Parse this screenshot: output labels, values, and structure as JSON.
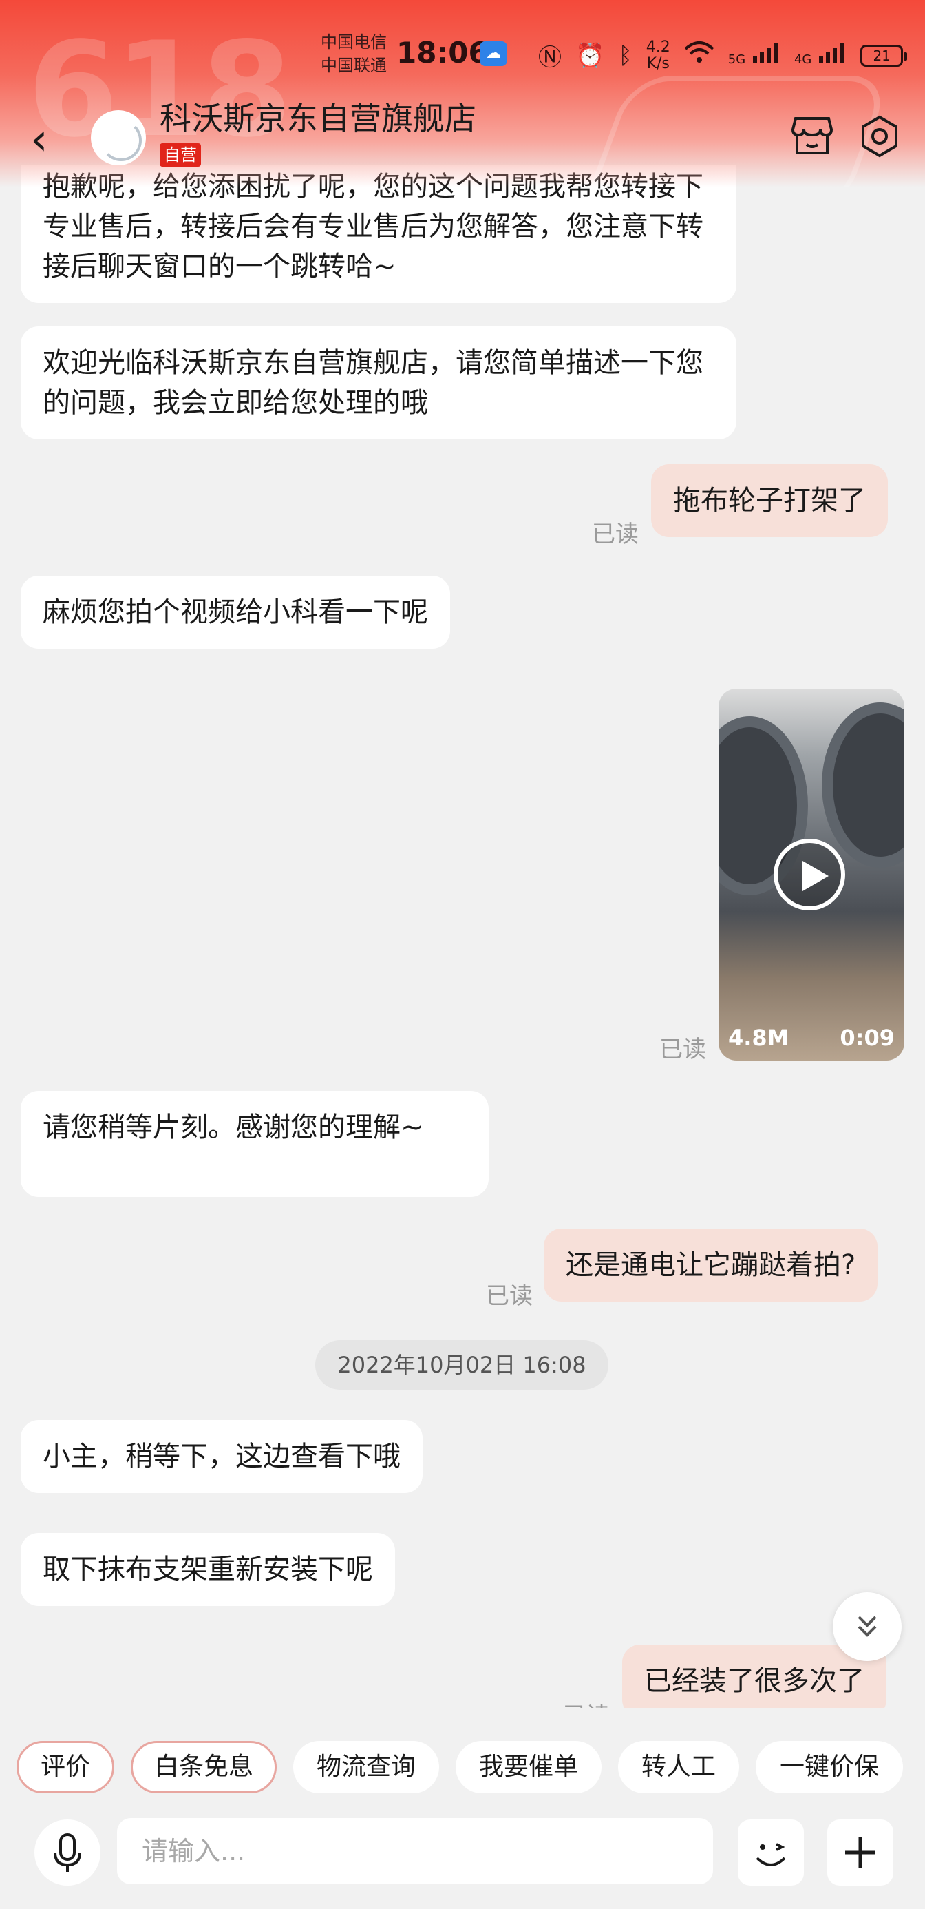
{
  "status_bar": {
    "carrier_1": "中国电信",
    "carrier_2": "中国联通",
    "time": "18:06",
    "net_speed_value": "4.2",
    "net_speed_unit": "K/s",
    "signal_1": "5G",
    "signal_2": "4G",
    "battery": "21"
  },
  "header": {
    "deco_text": "618",
    "shop_name": "科沃斯京东自营旗舰店",
    "badge": "自营"
  },
  "messages": [
    {
      "side": "left",
      "text": "抱歉呢，给您添困扰了呢，您的这个问题我帮您转接下专业售后，转接后会有专业售后为您解答，您注意下转接后聊天窗口的一个跳转哈~"
    },
    {
      "side": "left",
      "text": "欢迎光临科沃斯京东自营旗舰店，请您简单描述一下您的问题，我会立即给您处理的哦"
    },
    {
      "side": "right",
      "text": "拖布轮子打架了",
      "read": "已读"
    },
    {
      "side": "left",
      "text": "麻烦您拍个视频给小科看一下呢"
    },
    {
      "side": "right",
      "type": "video",
      "size": "4.8M",
      "duration": "0:09",
      "read": "已读"
    },
    {
      "side": "left",
      "text": "请您稍等片刻。感谢您的理解~"
    },
    {
      "side": "right",
      "text": "还是通电让它蹦跶着拍?",
      "read": "已读"
    },
    {
      "side": "left",
      "text": "小主，稍等下，这边查看下哦"
    },
    {
      "side": "left",
      "text": "取下抹布支架重新安装下呢"
    },
    {
      "side": "right",
      "text": "已经装了很多次了",
      "read": "已读"
    }
  ],
  "timestamp": "2022年10月02日 16:08",
  "quick_replies": [
    "评价",
    "白条免息",
    "物流查询",
    "我要催单",
    "转人工",
    "一键价保"
  ],
  "input": {
    "placeholder": "请输入..."
  },
  "icons": {
    "back": "back-chevron-icon",
    "store": "store-icon",
    "settings": "settings-icon",
    "mic": "microphone-icon",
    "emoji": "emoji-icon",
    "plus": "plus-icon",
    "scroll_down": "double-chevron-down-icon"
  },
  "colors": {
    "brand_red": "#e1251b",
    "header_red": "#f4493a",
    "right_bubble": "#f7e0d9",
    "left_bubble": "#ffffff",
    "background": "#f1f1f1"
  }
}
